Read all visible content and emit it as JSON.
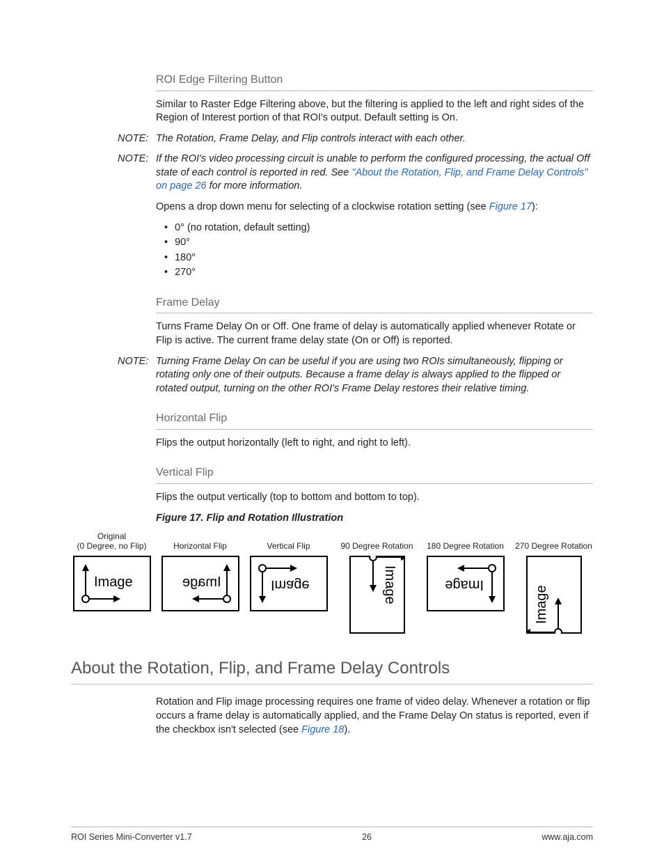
{
  "sections": {
    "roi_edge": {
      "title": "ROI Edge Filtering Button",
      "body": "Similar to Raster Edge Filtering above, but the filtering is applied to the left and right sides of the Region of Interest portion of that ROI's output. Default setting is On."
    },
    "note1": {
      "label": "NOTE:",
      "body": "The Rotation, Frame Delay, and Flip controls interact with each other."
    },
    "note2": {
      "label": "NOTE:",
      "body_a": "If the ROI's video processing circuit is unable to perform the configured processing, the actual Off state of each control is reported in red. See ",
      "link": "\"About the Rotation, Flip, and Frame Delay Controls\" on page 26",
      "body_b": " for more information."
    },
    "rotation": {
      "intro_a": "Opens a drop down menu for selecting of a clockwise rotation setting (see ",
      "intro_link": "Figure 17",
      "intro_b": "):",
      "items": [
        "0° (no rotation, default setting)",
        "90°",
        "180°",
        "270°"
      ]
    },
    "frame_delay": {
      "title": "Frame Delay",
      "body": "Turns Frame Delay On or Off. One frame of delay is automatically applied whenever Rotate or Flip is active. The current frame delay state (On or Off) is reported."
    },
    "note3": {
      "label": "NOTE:",
      "body": "Turning Frame Delay On can be useful if you are using two ROIs simultaneously, flipping or rotating only one of their outputs. Because a frame delay is always applied to the flipped or rotated output, turning on the other ROI's Frame Delay restores their relative timing."
    },
    "hflip": {
      "title": "Horizontal Flip",
      "body": "Flips the output horizontally (left to right, and right to left)."
    },
    "vflip": {
      "title": "Vertical Flip",
      "body": "Flips the output vertically (top to bottom and bottom to top)."
    },
    "figure": {
      "caption": "Figure 17.  Flip and Rotation Illustration",
      "labels": {
        "orig": "Original\n(0 Degree, no Flip)",
        "hflip": "Horizontal Flip",
        "vflip": "Vertical Flip",
        "r90": "90 Degree Rotation",
        "r180": "180 Degree Rotation",
        "r270": "270 Degree Rotation"
      },
      "word": "Image"
    },
    "about": {
      "title": "About the Rotation, Flip, and Frame Delay Controls",
      "body_a": "Rotation and Flip image processing requires one frame of video delay. Whenever a rotation or flip occurs a frame delay is automatically applied, and the Frame Delay On status is reported, even if the checkbox isn't selected (see ",
      "link": "Figure 18",
      "body_b": ")."
    }
  },
  "footer": {
    "left": "ROI Series Mini-Converter v1.7",
    "center": "26",
    "right": "www.aja.com"
  }
}
